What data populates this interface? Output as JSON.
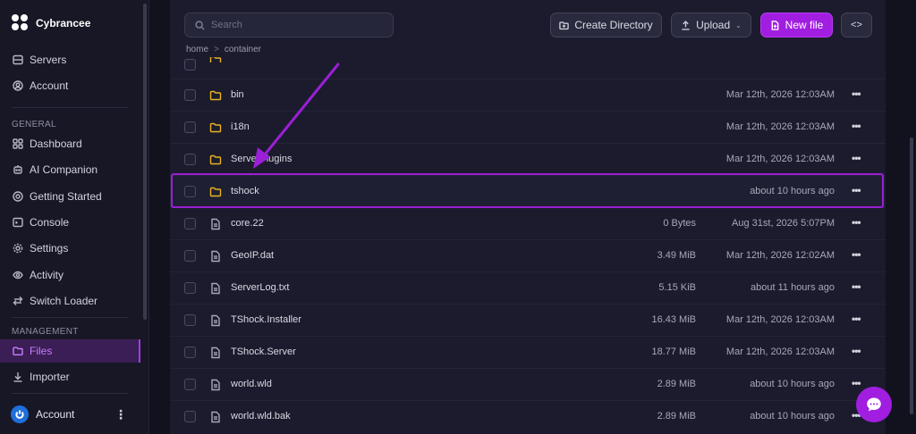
{
  "brand": {
    "name": "Cybrancee"
  },
  "sidebar": {
    "top_items": [
      {
        "label": "Servers",
        "icon": "servers-icon"
      },
      {
        "label": "Account",
        "icon": "account-icon"
      }
    ],
    "general_label": "GENERAL",
    "general_items": [
      {
        "label": "Dashboard",
        "icon": "dashboard-icon"
      },
      {
        "label": "AI Companion",
        "icon": "ai-companion-icon"
      },
      {
        "label": "Getting Started",
        "icon": "getting-started-icon"
      },
      {
        "label": "Console",
        "icon": "console-icon"
      },
      {
        "label": "Settings",
        "icon": "gear-icon"
      },
      {
        "label": "Activity",
        "icon": "eye-icon"
      },
      {
        "label": "Switch Loader",
        "icon": "switch-icon"
      }
    ],
    "management_label": "MANAGEMENT",
    "management_items": [
      {
        "label": "Files",
        "icon": "folder-icon",
        "active": true
      },
      {
        "label": "Importer",
        "icon": "download-icon"
      }
    ],
    "account_bottom": {
      "label": "Account"
    }
  },
  "toolbar": {
    "search_placeholder": "Search",
    "create_directory": "Create Directory",
    "upload": "Upload",
    "new_file": "New file",
    "code_toggle": "<>"
  },
  "breadcrumb": {
    "parts": [
      "home",
      "container"
    ]
  },
  "files": [
    {
      "name": "bin",
      "type": "folder",
      "size": "",
      "modified": "Mar 12th, 2026 12:03AM"
    },
    {
      "name": "i18n",
      "type": "folder",
      "size": "",
      "modified": "Mar 12th, 2026 12:03AM"
    },
    {
      "name": "ServerPlugins",
      "type": "folder",
      "size": "",
      "modified": "Mar 12th, 2026 12:03AM"
    },
    {
      "name": "tshock",
      "type": "folder",
      "size": "",
      "modified": "about 10 hours ago"
    },
    {
      "name": "core.22",
      "type": "file",
      "size": "0 Bytes",
      "modified": "Aug 31st, 2026 5:07PM"
    },
    {
      "name": "GeoIP.dat",
      "type": "file",
      "size": "3.49 MiB",
      "modified": "Mar 12th, 2026 12:02AM"
    },
    {
      "name": "ServerLog.txt",
      "type": "file",
      "size": "5.15 KiB",
      "modified": "about 11 hours ago"
    },
    {
      "name": "TShock.Installer",
      "type": "file",
      "size": "16.43 MiB",
      "modified": "Mar 12th, 2026 12:03AM"
    },
    {
      "name": "TShock.Server",
      "type": "file",
      "size": "18.77 MiB",
      "modified": "Mar 12th, 2026 12:03AM"
    },
    {
      "name": "world.wld",
      "type": "file",
      "size": "2.89 MiB",
      "modified": "about 10 hours ago"
    },
    {
      "name": "world.wld.bak",
      "type": "file",
      "size": "2.89 MiB",
      "modified": "about 10 hours ago"
    }
  ],
  "colors": {
    "accent": "#a11ee0",
    "highlight": "#9b1fd6",
    "folder": "#e6b422",
    "sidebar_bg": "#171726",
    "panel_bg": "#1b1b2d"
  }
}
